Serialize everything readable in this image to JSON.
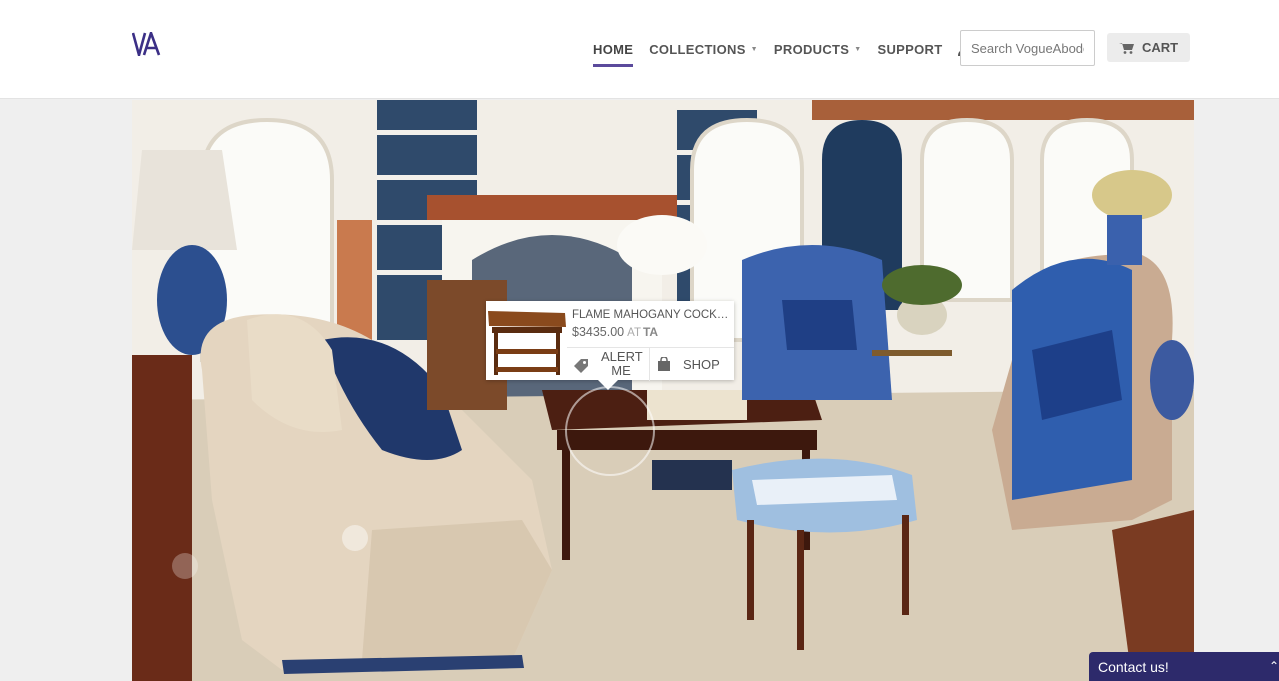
{
  "header": {
    "logo_text": "VA",
    "nav": [
      {
        "label": "HOME",
        "active": true
      },
      {
        "label": "COLLECTIONS",
        "dropdown": true
      },
      {
        "label": "PRODUCTS",
        "dropdown": true
      },
      {
        "label": "SUPPORT"
      }
    ],
    "search_placeholder": "Search VogueAbode...",
    "cart_label": "CART",
    "accent_color": "#5b4a9c"
  },
  "popup": {
    "product_name": "FLAME MAHOGANY COCKTAIL TABLE",
    "price": "$3435.00",
    "at": "AT",
    "store": "TA",
    "alert_label": "ALERT ME",
    "shop_label": "SHOP"
  },
  "contact": {
    "label": "Contact us!",
    "background": "#2d2a6b"
  }
}
